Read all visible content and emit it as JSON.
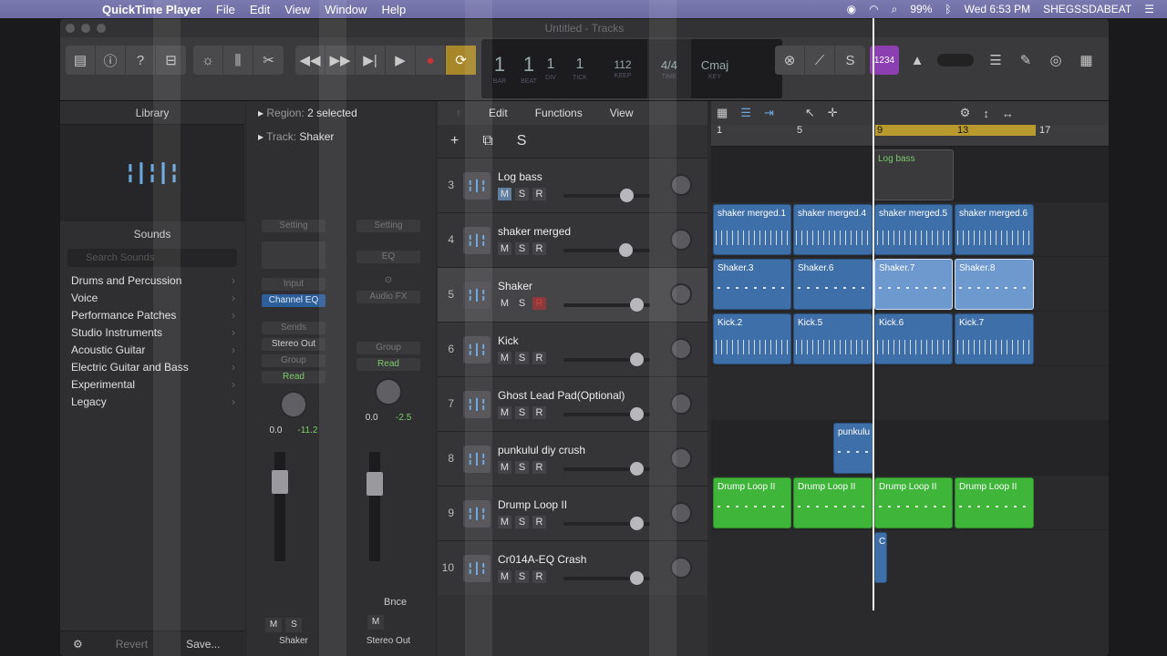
{
  "menubar": {
    "app": "QuickTime Player",
    "items": [
      "File",
      "Edit",
      "View",
      "Window",
      "Help"
    ],
    "battery": "99%",
    "clock": "Wed 6:53 PM",
    "user": "SHEGSSDABEAT"
  },
  "window": {
    "title": "Untitled - Tracks"
  },
  "lcd": {
    "bar": "1",
    "beat": "1",
    "div": "1",
    "tick": "1",
    "tempo": "112",
    "tempo_label": "KEEP",
    "sig": "4/4",
    "key": "Cmaj",
    "count_in": "1234"
  },
  "library": {
    "header": "Library",
    "sounds_label": "Sounds",
    "search_placeholder": "Search Sounds",
    "categories": [
      "Drums and Percussion",
      "Voice",
      "Performance Patches",
      "Studio Instruments",
      "Acoustic Guitar",
      "Electric Guitar and Bass",
      "Experimental",
      "Legacy"
    ],
    "revert": "Revert",
    "save": "Save..."
  },
  "inspector": {
    "region_label": "Region:",
    "region_value": "2 selected",
    "track_label": "Track:",
    "track_value": "Shaker",
    "strip1": {
      "setting": "Setting",
      "input": "Input",
      "eq": "Channel EQ",
      "sends": "Sends",
      "out": "Stereo Out",
      "group": "Group",
      "auto": "Read",
      "vol": "0.0",
      "peak": "-11.2",
      "m": "M",
      "s": "S",
      "name": "Shaker"
    },
    "strip2": {
      "setting": "Setting",
      "eq": "EQ",
      "audiofx": "Audio FX",
      "group": "Group",
      "auto": "Read",
      "vol": "0.0",
      "peak": "-2.5",
      "bnce": "Bnce",
      "m": "M",
      "name": "Stereo Out"
    }
  },
  "tracks_header": {
    "edit": "Edit",
    "functions": "Functions",
    "view": "View"
  },
  "tracks": [
    {
      "num": "3",
      "name": "Log bass",
      "m_on": true
    },
    {
      "num": "4",
      "name": "shaker merged"
    },
    {
      "num": "5",
      "name": "Shaker",
      "selected": true,
      "r_on": true
    },
    {
      "num": "6",
      "name": "Kick"
    },
    {
      "num": "7",
      "name": "Ghost Lead Pad(Optional)"
    },
    {
      "num": "8",
      "name": "punkulul  diy crush"
    },
    {
      "num": "9",
      "name": "Drump Loop II"
    },
    {
      "num": "10",
      "name": "Cr014A-EQ Crash"
    }
  ],
  "ruler": [
    "1",
    "5",
    "9",
    "13",
    "17"
  ],
  "regions": {
    "logbass": "Log bass",
    "shakermerged": [
      "shaker merged.1",
      "shaker merged.4",
      "shaker merged.5",
      "shaker merged.6"
    ],
    "shaker": [
      "Shaker.3",
      "Shaker.6",
      "Shaker.7",
      "Shaker.8"
    ],
    "kick": [
      "Kick.2",
      "Kick.5",
      "Kick.6",
      "Kick.7"
    ],
    "punkulul": "punkulu",
    "drum": [
      "Drump Loop II",
      "Drump Loop II",
      "Drump Loop II",
      "Drump Loop II"
    ],
    "crash": "C"
  },
  "colors": {
    "region_blue": "#3e6fa8",
    "region_green": "#3fb63a",
    "cycle": "#b99a2e"
  }
}
